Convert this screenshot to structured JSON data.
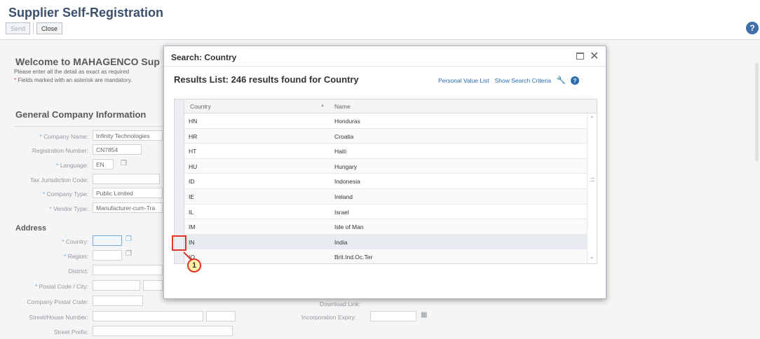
{
  "shell": {
    "title": "Supplier Self-Registration",
    "send_label": "Send",
    "close_label": "Close",
    "help_icon": "?"
  },
  "form": {
    "welcome": "Welcome to MAHAGENCO Sup",
    "note1": "Please enter all the detail as exact as required",
    "note2": "Fields marked with an asterisk are mandatory.",
    "general_heading": "General Company Information",
    "address_heading": "Address",
    "company_name_label": "Company Name:",
    "company_name_value": "Infinity Technologies",
    "reg_number_label": "Registration Number:",
    "reg_number_value": "CN7854",
    "language_label": "Language:",
    "language_value": "EN",
    "tax_label": "Tax Jurisdiction Code:",
    "company_type_label": "Company Type:",
    "company_type_value": "Public Limited",
    "vendor_type_label": "Vendor Type:",
    "vendor_type_value": "Manufacturer-cum-Tra",
    "country_label": "Country:",
    "region_label": "Region:",
    "district_label": "District:",
    "postal_city_label": "Postal Code / City:",
    "company_postal_label": "Company Postal Code:",
    "street_label": "Street/House Number:",
    "street_prefix_label": "Street Prefix:",
    "download_link_label": "Download Link:",
    "incorporation_label": "Incorporation Expiry:"
  },
  "dialog": {
    "title": "Search: Country",
    "results_title": "Results List: 246 results found for Country",
    "personal_value_list": "Personal Value List",
    "show_search_criteria": "Show Search Criteria",
    "columns": [
      "Country",
      "Name"
    ],
    "rows": [
      {
        "code": "HN",
        "name": "Honduras"
      },
      {
        "code": "HR",
        "name": "Croatia"
      },
      {
        "code": "HT",
        "name": "Haiti"
      },
      {
        "code": "HU",
        "name": "Hungary"
      },
      {
        "code": "ID",
        "name": "Indonesia"
      },
      {
        "code": "IE",
        "name": "Ireland"
      },
      {
        "code": "IL",
        "name": "Israel"
      },
      {
        "code": "IM",
        "name": "Isle of Man"
      },
      {
        "code": "IN",
        "name": "India"
      },
      {
        "code": "IO",
        "name": "Brit.Ind.Oc.Ter"
      }
    ]
  },
  "annotation": {
    "number": "1",
    "color": "#e0352b"
  }
}
